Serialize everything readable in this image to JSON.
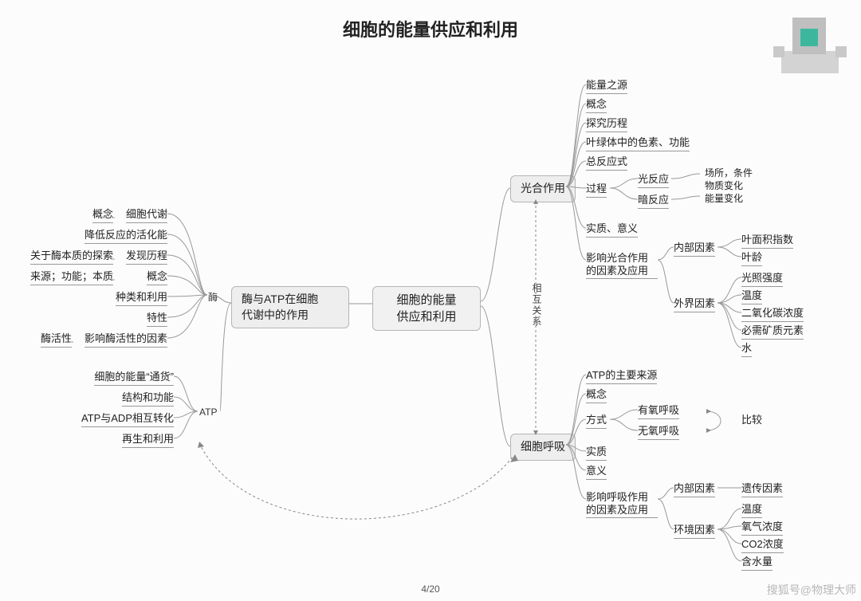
{
  "title": "细胞的能量供应和利用",
  "page": "4/20",
  "watermark": "搜狐号@物理大师",
  "center": "细胞的能量\n供应和利用",
  "enzyme_atp_node": "酶与ATP在细胞\n代谢中的作用",
  "photosyn_node": "光合作用",
  "resp_node": "细胞呼吸",
  "label_enzyme": "酶",
  "label_atp": "ATP",
  "rel_label": "相互关系",
  "compare_label": "比较",
  "enzyme": {
    "a1_l": "概念",
    "a1_r": "细胞代谢",
    "a2_r": "降低反应的活化能",
    "a3_l": "关于酶本质的探索",
    "a3_r": "发现历程",
    "a4_l": "来源；功能；本质",
    "a4_r": "概念",
    "a5_r": "种类和利用",
    "a6_r": "特性",
    "a7_l": "酶活性",
    "a7_r": "影响酶活性的因素"
  },
  "atp": {
    "b1": "细胞的能量“通货”",
    "b2": "结构和功能",
    "b3": "ATP与ADP相互转化",
    "b4": "再生和利用"
  },
  "photo": {
    "p1": "能量之源",
    "p2": "概念",
    "p3": "探究历程",
    "p4": "叶绿体中的色素、功能",
    "p5": "总反应式",
    "p6": "过程",
    "p6a": "光反应",
    "p6b": "暗反应",
    "p6_note1": "场所，条件",
    "p6_note2": "物质变化",
    "p6_note3": "能量变化",
    "p7": "实质、意义",
    "p8": "影响光合作用的因素及应用",
    "p8_in": "内部因素",
    "p8_in_a": "叶面积指数",
    "p8_in_b": "叶龄",
    "p8_out": "外界因素",
    "p8_out_a": "光照强度",
    "p8_out_b": "温度",
    "p8_out_c": "二氧化碳浓度",
    "p8_out_d": "必需矿质元素",
    "p8_out_e": "水"
  },
  "resp": {
    "r1": "ATP的主要来源",
    "r2": "概念",
    "r3": "方式",
    "r3a": "有氧呼吸",
    "r3b": "无氧呼吸",
    "r4": "实质",
    "r5": "意义",
    "r6": "影响呼吸作用的因素及应用",
    "r6_in": "内部因素",
    "r6_in_a": "遗传因素",
    "r6_out": "环境因素",
    "r6_out_a": "温度",
    "r6_out_b": "氧气浓度",
    "r6_out_c": "CO2浓度",
    "r6_out_d": "含水量"
  }
}
